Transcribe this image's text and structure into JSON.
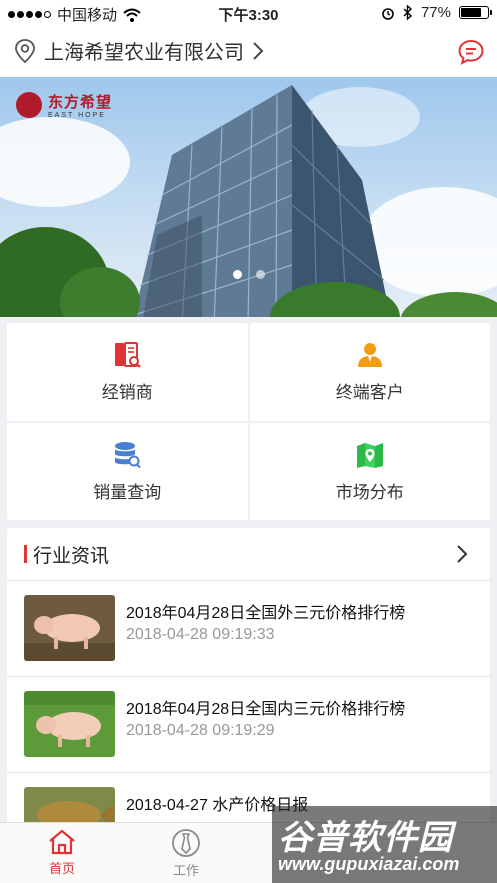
{
  "status_bar": {
    "carrier": "中国移动",
    "time": "下午3:30",
    "battery": "77%",
    "battery_level": 0.77
  },
  "header": {
    "company_name": "上海希望农业有限公司",
    "location_icon": "location-pin-icon",
    "chevron_icon": "chevron-right-icon",
    "message_icon": "chat-bubble-icon",
    "accent_color": "#e03434"
  },
  "banner": {
    "logo_cn": "东方希望",
    "logo_en": "EAST HOPE",
    "slide_count": 2,
    "active_slide": 0
  },
  "menu": [
    {
      "label": "经销商",
      "icon": "book-search-icon",
      "color": "#e03434"
    },
    {
      "label": "终端客户",
      "icon": "person-icon",
      "color": "#f39c12"
    },
    {
      "label": "销量查询",
      "icon": "database-search-icon",
      "color": "#4a7fd4"
    },
    {
      "label": "市场分布",
      "icon": "map-pin-icon",
      "color": "#2db84a"
    }
  ],
  "news": {
    "section_title": "行业资讯",
    "items": [
      {
        "title": "2018年04月28日全国外三元价格排行榜",
        "time": "2018-04-28 09:19:33",
        "thumb": "pig-photo"
      },
      {
        "title": "2018年04月28日全国内三元价格排行榜",
        "time": "2018-04-28 09:19:29",
        "thumb": "pig-grass-photo"
      },
      {
        "title": "2018-04-27 水产价格日报",
        "time": "",
        "thumb": "fish-photo"
      }
    ]
  },
  "tabs": [
    {
      "label": "首页",
      "icon": "home-icon",
      "active": true
    },
    {
      "label": "工作",
      "icon": "tie-icon",
      "active": false
    }
  ],
  "watermark": {
    "cn": "谷普软件园",
    "en": "www.gupuxiazai.com"
  }
}
